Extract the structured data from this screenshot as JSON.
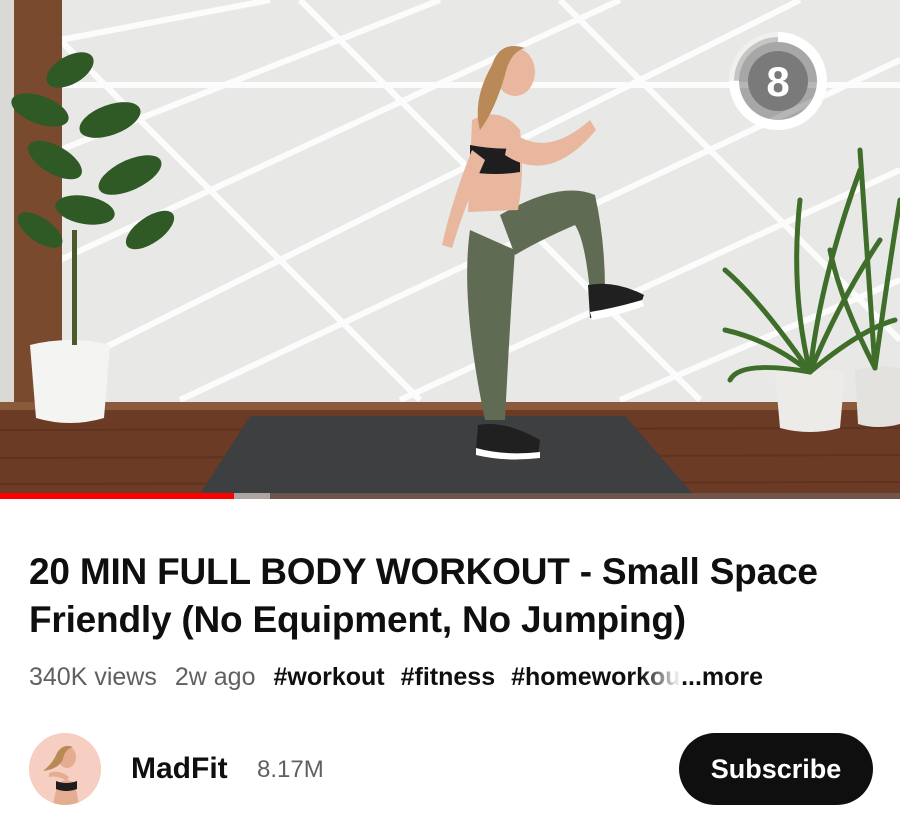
{
  "video": {
    "timer_value": "8",
    "timer_fraction": 0.75,
    "progress_fraction": 0.26,
    "buffer_fraction": 0.3
  },
  "title": "20 MIN FULL BODY WORKOUT -  Small Space Friendly (No Equipment, No Jumping)",
  "meta": {
    "views": "340K views",
    "age": "2w ago",
    "tags": [
      "#workout",
      "#fitness",
      "#homeworkout"
    ],
    "more_label": "...more"
  },
  "channel": {
    "name": "MadFit",
    "subscribers": "8.17M",
    "subscribe_label": "Subscribe"
  },
  "colors": {
    "progress": "#ff0000",
    "subscribe_bg": "#0f0f0f",
    "secondary_text": "#606060"
  }
}
